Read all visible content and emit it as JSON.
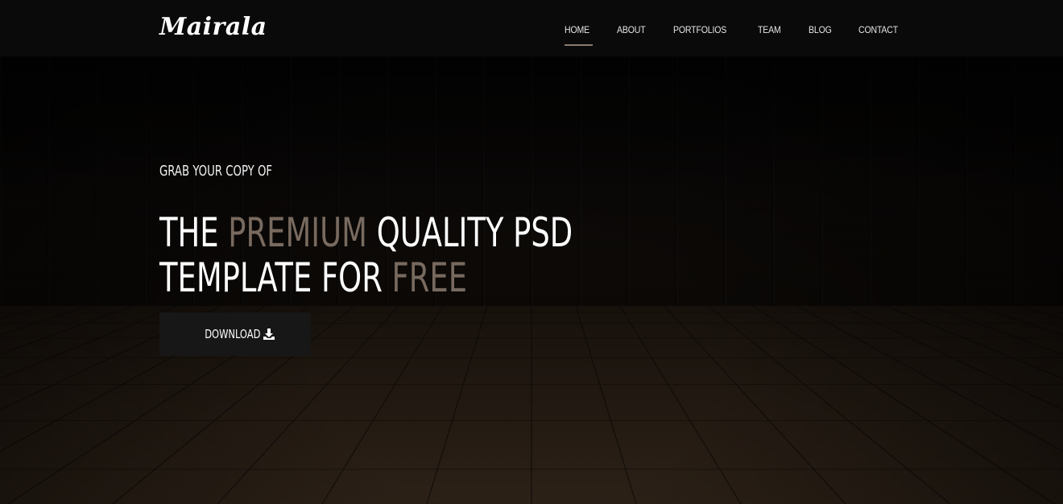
{
  "brand": {
    "logo_text": "Mairala"
  },
  "nav": {
    "items": [
      {
        "label": "HOME",
        "active": true
      },
      {
        "label": "ABOUT",
        "active": false
      },
      {
        "label": "PORTFOLIOS",
        "active": false
      },
      {
        "label": "TEAM",
        "active": false
      },
      {
        "label": "BLOG",
        "active": false
      },
      {
        "label": "CONTACT",
        "active": false
      }
    ]
  },
  "hero": {
    "eyebrow": "GRAB YOUR COPY OF",
    "headline": {
      "part1": "THE ",
      "accent1": "PREMIUM",
      "part2": " QUALITY PSD",
      "part3": "TEMPLATE FOR ",
      "accent2": "FREE"
    },
    "button": {
      "label": "DOWNLOAD",
      "icon": "download-icon"
    }
  },
  "colors": {
    "accent": "#786a5f",
    "nav_underline": "#8a7b6c",
    "navbar_bg": "#0a0a0a",
    "button_bg": "#171717"
  }
}
